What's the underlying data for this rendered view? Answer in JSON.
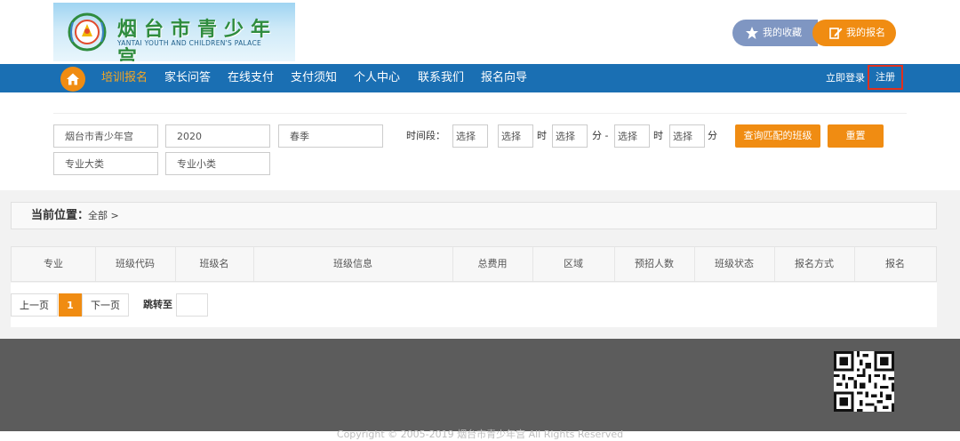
{
  "logo": {
    "title_cn": "烟台市青少年宫",
    "title_en": "YANTAI YOUTH AND CHILDREN'S PALACE"
  },
  "header_buttons": {
    "favorites": "我的收藏",
    "my_registration": "我的报名"
  },
  "nav": {
    "items": [
      "培训报名",
      "家长问答",
      "在线支付",
      "支付须知",
      "个人中心",
      "联系我们",
      "报名向导"
    ],
    "login": "立即登录",
    "register": "注册"
  },
  "filters": {
    "institution": "烟台市青少年宫",
    "year": "2020",
    "season": "春季",
    "time_label": "时间段：",
    "select": "选择",
    "hour": "时",
    "minute_dash": "分 -",
    "minute": "分",
    "major_category": "专业大类",
    "major_subcategory": "专业小类",
    "search_button": "查询匹配的班级",
    "reset_button": "重置"
  },
  "breadcrumb": {
    "title": "当前位置：",
    "path": "全部 >"
  },
  "table": {
    "headers": [
      "专业",
      "班级代码",
      "班级名",
      "班级信息",
      "总费用",
      "区域",
      "预招人数",
      "班级状态",
      "报名方式",
      "报名"
    ]
  },
  "pagination": {
    "prev": "上一页",
    "current": "1",
    "next": "下一页",
    "jump": "跳转至"
  },
  "footer": {
    "copyright": "Copyright © 2005-2019 烟台市青少年宫 All Rights Reserved"
  },
  "colors": {
    "nav_blue": "#1a6fb3",
    "accent_orange": "#f08c12",
    "active_nav": "#f5a623",
    "footer_gray": "#5c5c5c"
  }
}
